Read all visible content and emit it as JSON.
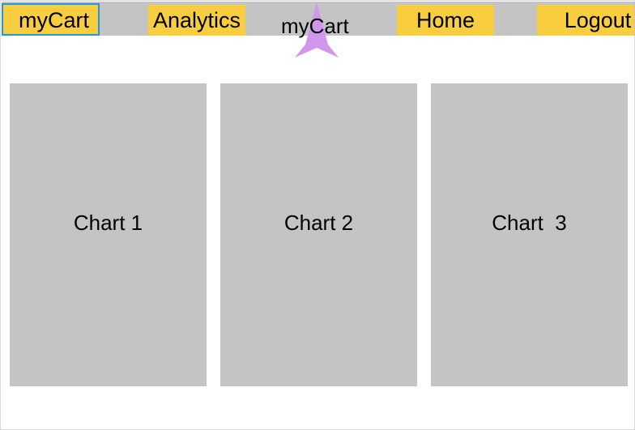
{
  "nav": {
    "mycart_label": "myCart",
    "analytics_label": "Analytics",
    "home_label": "Home",
    "logout_label": "Logout"
  },
  "brand": {
    "label": "myCart",
    "star_color": "#d197ec"
  },
  "charts": [
    {
      "label": "Chart 1"
    },
    {
      "label": "Chart 2"
    },
    {
      "label": "Chart  3"
    }
  ],
  "colors": {
    "button_bg": "#f8cd3f",
    "topbar_bg": "#c4c4c4",
    "card_bg": "#c4c4c4",
    "focus_border": "#1e9ad6"
  }
}
